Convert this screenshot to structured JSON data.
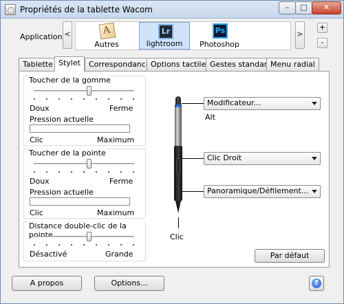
{
  "window": {
    "title": "Propriétés de la tablette Wacom",
    "controls": {
      "minimize": "–",
      "maximize": "□",
      "close": "✕"
    }
  },
  "appbar": {
    "label": "Application:",
    "prev": "<",
    "next": ">",
    "add": "+",
    "remove": "-",
    "apps": [
      {
        "label": "Autres",
        "icon": "autres-icon",
        "selected": false
      },
      {
        "label": "lightroom",
        "icon": "lightroom-icon",
        "icon_text": "Lr",
        "selected": true
      },
      {
        "label": "Photoshop",
        "icon": "photoshop-icon",
        "icon_text": "Ps",
        "selected": false
      }
    ]
  },
  "tabs": [
    {
      "label": "Tablette"
    },
    {
      "label": "Stylet",
      "active": true
    },
    {
      "label": "Correspondance"
    },
    {
      "label": "Options tactiles"
    },
    {
      "label": "Gestes standard"
    },
    {
      "label": "Menu radial"
    }
  ],
  "stylet": {
    "eraser_feel": {
      "title": "Toucher de la gomme",
      "min_label": "Doux",
      "max_label": "Ferme",
      "level": 0.55,
      "pressure_label": "Pression actuelle",
      "pressure_min": "Clic",
      "pressure_max": "Maximum"
    },
    "tip_feel": {
      "title": "Toucher de la pointe",
      "min_label": "Doux",
      "max_label": "Ferme",
      "level": 0.55,
      "pressure_label": "Pression actuelle",
      "pressure_min": "Clic",
      "pressure_max": "Maximum"
    },
    "double_click": {
      "title": "Distance double-clic de la pointe",
      "min_label": "Désactivé",
      "max_label": "Grande",
      "level": 0.55
    },
    "buttons": {
      "top": {
        "value": "Modificateur...",
        "sub": "Alt"
      },
      "upper_side": {
        "value": "Clic Droit"
      },
      "lower_side": {
        "value": "Panoramique/Défilement..."
      },
      "tip": {
        "label": "Clic"
      }
    },
    "default_button": "Par défaut"
  },
  "footer": {
    "about": "A propos",
    "options": "Options...",
    "help_icon": "?"
  },
  "colors": {
    "selected_app": "#cfe3fb",
    "pen_ring": "#3b7cf2",
    "help": "#1f56c9"
  }
}
